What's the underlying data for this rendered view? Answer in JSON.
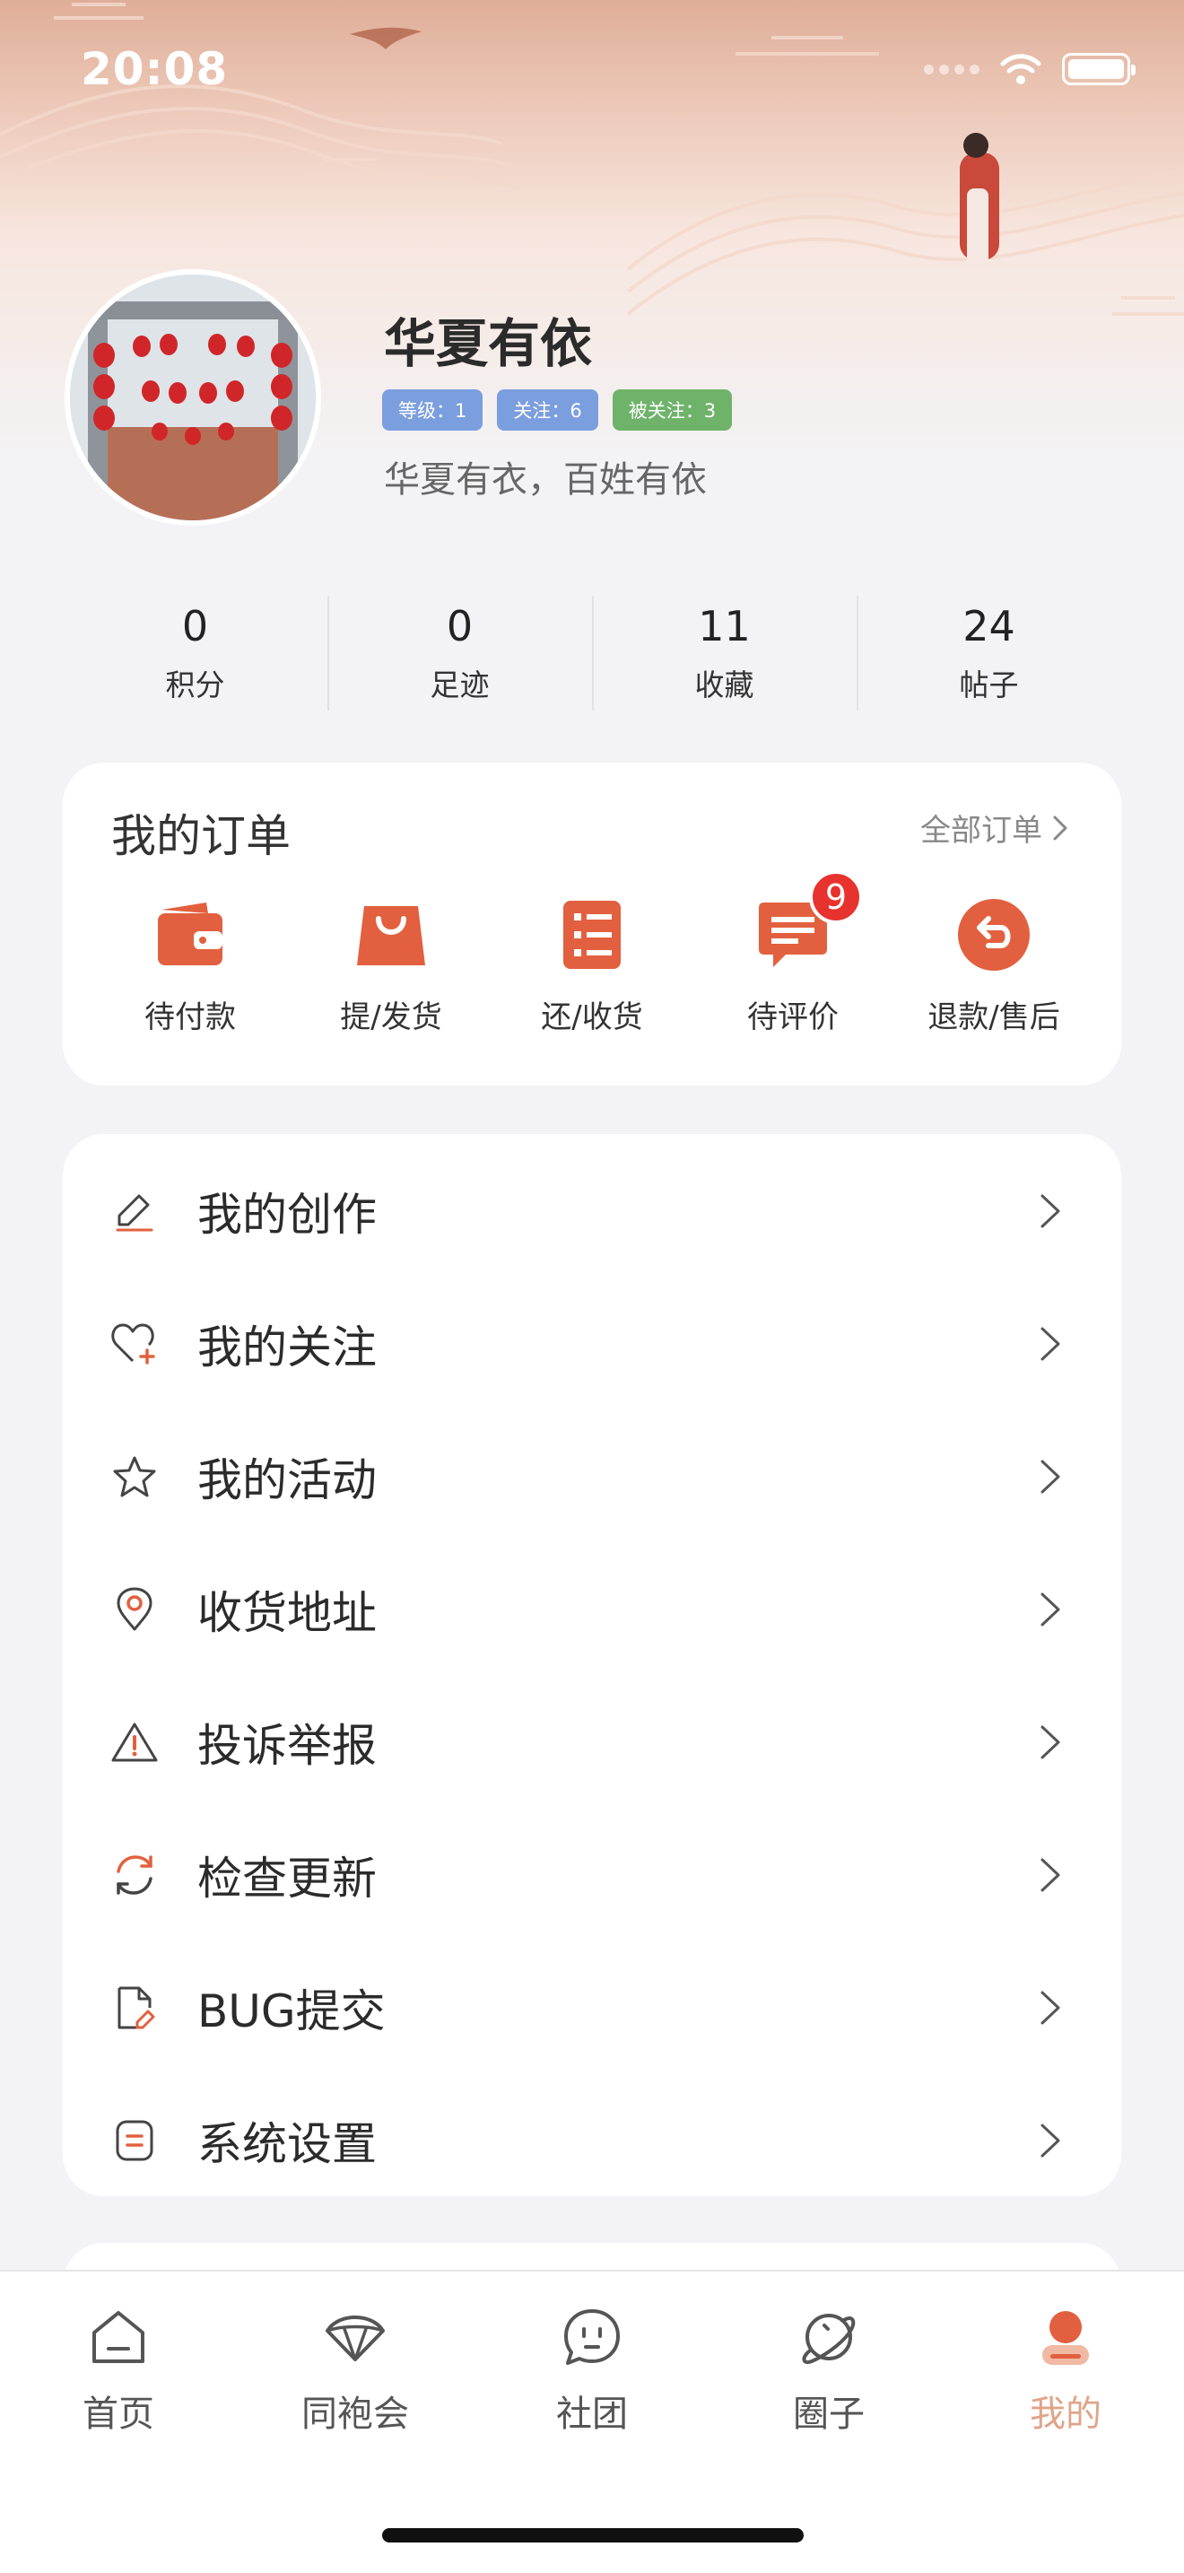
{
  "status_bar": {
    "time": "20:08"
  },
  "profile": {
    "name": "华夏有依",
    "tags": [
      {
        "label": "等级：1",
        "color": "#7b9ede"
      },
      {
        "label": "关注：6",
        "color": "#7b9ede"
      },
      {
        "label": "被关注：3",
        "color": "#6fb36a"
      }
    ],
    "motto": "华夏有衣，百姓有依"
  },
  "stats": [
    {
      "value": "0",
      "label": "积分"
    },
    {
      "value": "0",
      "label": "足迹"
    },
    {
      "value": "11",
      "label": "收藏"
    },
    {
      "value": "24",
      "label": "帖子"
    }
  ],
  "orders": {
    "title": "我的订单",
    "all_label": "全部订单",
    "items": [
      {
        "label": "待付款",
        "icon": "wallet-icon"
      },
      {
        "label": "提/发货",
        "icon": "shopping-bag-icon"
      },
      {
        "label": "还/收货",
        "icon": "list-icon"
      },
      {
        "label": "待评价",
        "icon": "comment-icon",
        "badge": "9"
      },
      {
        "label": "退款/售后",
        "icon": "return-icon"
      }
    ]
  },
  "menu": [
    {
      "label": "我的创作",
      "icon": "pencil-icon"
    },
    {
      "label": "我的关注",
      "icon": "heart-plus-icon"
    },
    {
      "label": "我的活动",
      "icon": "star-icon"
    },
    {
      "label": "收货地址",
      "icon": "location-pin-icon"
    },
    {
      "label": "投诉举报",
      "icon": "warning-icon"
    },
    {
      "label": "检查更新",
      "icon": "refresh-icon"
    },
    {
      "label": "BUG提交",
      "icon": "document-edit-icon"
    },
    {
      "label": "系统设置",
      "icon": "settings-icon"
    }
  ],
  "tabbar": [
    {
      "label": "首页",
      "icon": "home-icon"
    },
    {
      "label": "同袍会",
      "icon": "umbrella-icon"
    },
    {
      "label": "社团",
      "icon": "chat-face-icon"
    },
    {
      "label": "圈子",
      "icon": "planet-icon"
    },
    {
      "label": "我的",
      "icon": "user-icon",
      "active": true
    }
  ],
  "colors": {
    "accent": "#e2603f",
    "tab_active": "#e0a488",
    "badge": "#e8322e"
  }
}
